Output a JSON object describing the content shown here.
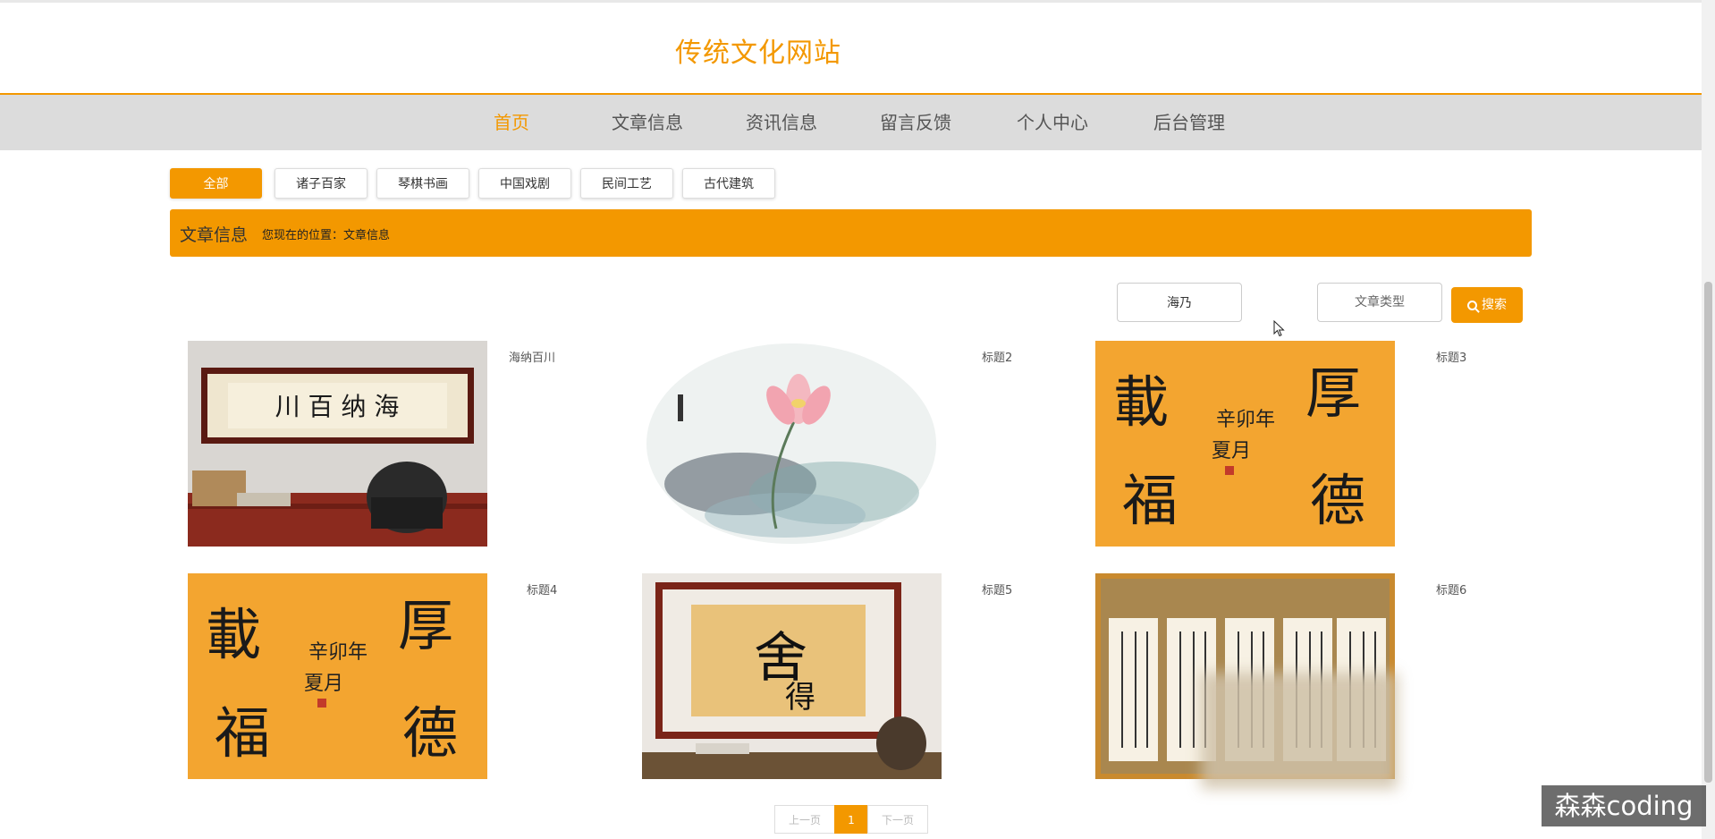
{
  "site": {
    "title": "传统文化网站"
  },
  "nav": {
    "items": [
      {
        "label": "首页",
        "active": true
      },
      {
        "label": "文章信息",
        "active": false
      },
      {
        "label": "资讯信息",
        "active": false
      },
      {
        "label": "留言反馈",
        "active": false
      },
      {
        "label": "个人中心",
        "active": false
      },
      {
        "label": "后台管理",
        "active": false
      }
    ]
  },
  "categories": [
    "全部",
    "诸子百家",
    "琴棋书画",
    "中国戏剧",
    "民间工艺",
    "古代建筑"
  ],
  "banner": {
    "title": "文章信息",
    "location": "您现在的位置：文章信息"
  },
  "search": {
    "value": "海乃",
    "type_placeholder": "文章类型",
    "button_label": "搜索"
  },
  "articles": [
    {
      "title": "海纳百川",
      "image": "framed-calligraphy-office"
    },
    {
      "title": "标题2",
      "image": "lotus-ink-painting"
    },
    {
      "title": "标题3",
      "image": "calligraphy-orange"
    },
    {
      "title": "标题4",
      "image": "calligraphy-orange"
    },
    {
      "title": "标题5",
      "image": "framed-calligraphy-shede"
    },
    {
      "title": "标题6",
      "image": "calligraphy-scrolls"
    }
  ],
  "pagination": {
    "prev": "上一页",
    "current": "1",
    "next": "下一页"
  },
  "watermark": "森森coding",
  "colors": {
    "accent": "#f39800",
    "nav_bg": "#dcdcdc"
  }
}
